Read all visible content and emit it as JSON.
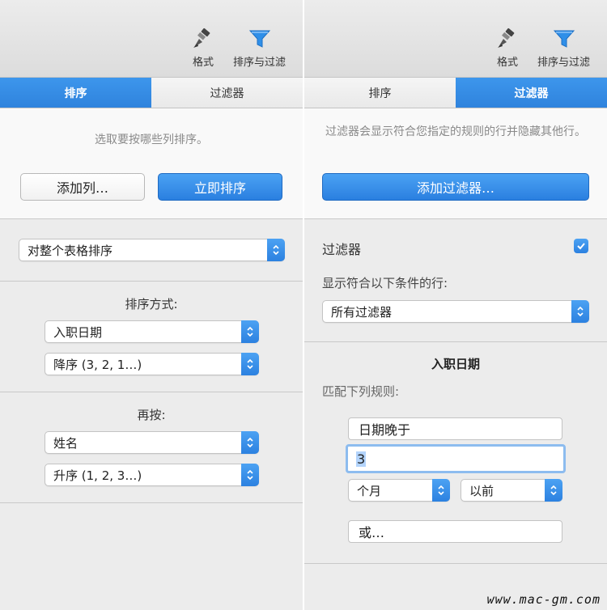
{
  "left": {
    "toolbar": {
      "format_label": "格式",
      "sort_filter_label": "排序与过滤"
    },
    "tabs": [
      {
        "label": "排序",
        "active": true
      },
      {
        "label": "过滤器",
        "active": false
      }
    ],
    "hint": "选取要按哪些列排序。",
    "add_column_label": "添加列…",
    "sort_now_label": "立即排序",
    "scope_select": "对整个表格排序",
    "sort_by_label": "排序方式:",
    "sort_by_column": "入职日期",
    "sort_by_order": "降序 (3, 2, 1…)",
    "then_by_label": "再按:",
    "then_by_column": "姓名",
    "then_by_order": "升序 (1, 2, 3…)"
  },
  "right": {
    "toolbar": {
      "format_label": "格式",
      "sort_filter_label": "排序与过滤"
    },
    "tabs": [
      {
        "label": "排序",
        "active": false
      },
      {
        "label": "过滤器",
        "active": true
      }
    ],
    "hint": "过滤器会显示符合您指定的规则的行并隐藏其他行。",
    "add_filter_label": "添加过滤器…",
    "filter_title": "过滤器",
    "filter_enabled": true,
    "show_rows_label": "显示符合以下条件的行:",
    "match_select": "所有过滤器",
    "rule_column": "入职日期",
    "match_rules_label": "匹配下列规则:",
    "rule_condition": "日期晚于",
    "rule_value": "3",
    "rule_unit": "个月",
    "rule_direction": "以前",
    "or_label": "或…"
  },
  "watermark": "www.mac-gm.com",
  "colors": {
    "accent": "#2f83dd",
    "panel_bg": "#ececec"
  },
  "icons": {
    "format": "paintbrush-icon",
    "sort_filter": "funnel-icon",
    "stepper": "updown-chevron-icon",
    "check": "checkmark-icon"
  }
}
